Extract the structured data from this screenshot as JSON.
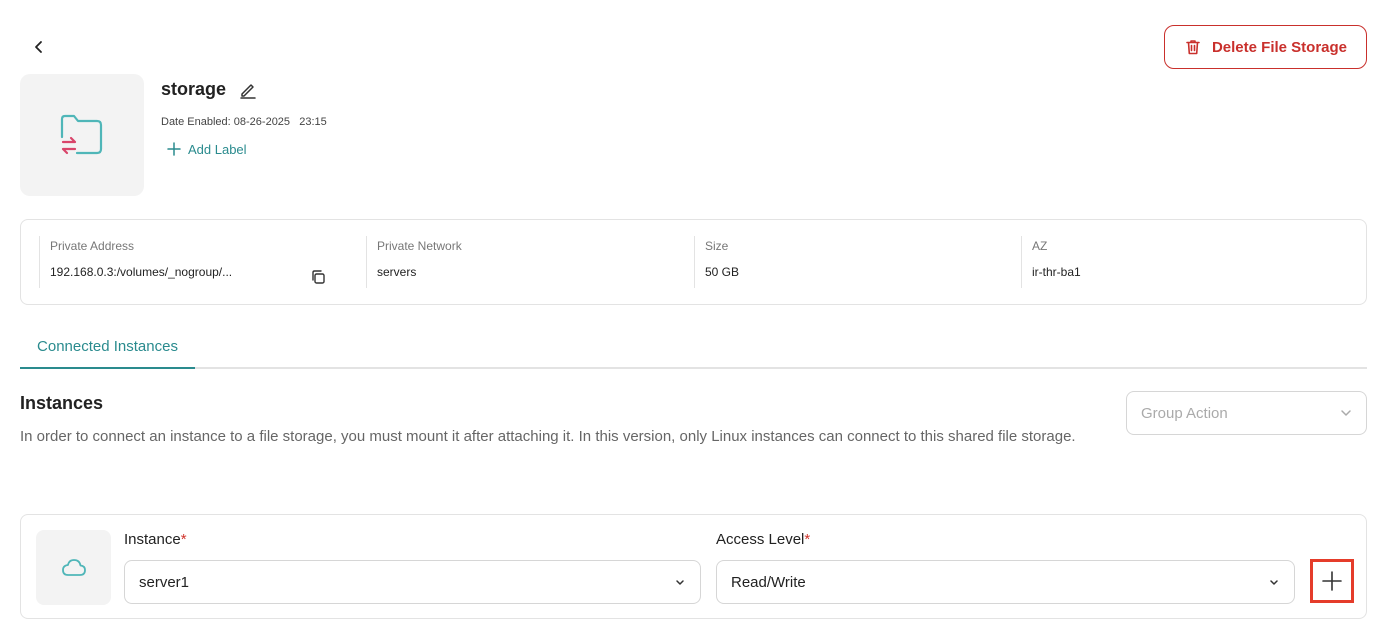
{
  "header": {
    "delete_label": "Delete File Storage"
  },
  "storage": {
    "name": "storage",
    "date_enabled": "Date Enabled: 08-26-2025   23:15",
    "add_label": "Add Label"
  },
  "info": {
    "private_address": {
      "label": "Private Address",
      "value": "192.168.0.3:/volumes/_nogroup/..."
    },
    "private_network": {
      "label": "Private Network",
      "value": "servers"
    },
    "size": {
      "label": "Size",
      "value": "50 GB"
    },
    "az": {
      "label": "AZ",
      "value": "ir-thr-ba1"
    }
  },
  "tabs": [
    {
      "label": "Connected Instances",
      "active": true
    }
  ],
  "instances_section": {
    "title": "Instances",
    "description": "In order to connect an instance to a file storage, you must mount it after attaching it. In this version, only Linux instances can connect to this shared file storage.",
    "group_action_placeholder": "Group Action"
  },
  "instance_row": {
    "instance_label": "Instance",
    "instance_value": "server1",
    "access_label": "Access Level",
    "access_value": "Read/Write",
    "required_mark": "*"
  },
  "colors": {
    "accent": "#2a8b8e",
    "danger": "#c9302c",
    "highlight": "#e53c2a"
  }
}
